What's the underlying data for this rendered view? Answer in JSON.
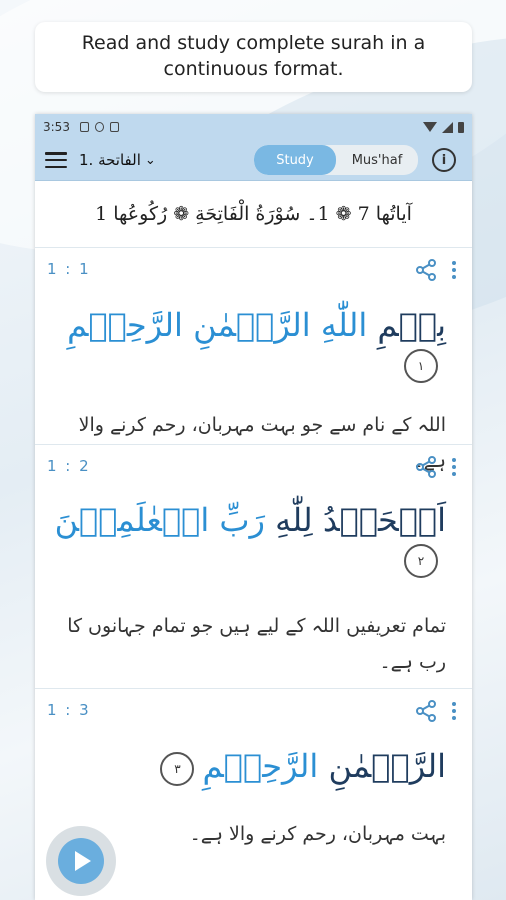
{
  "banner": {
    "text": "Read and study complete surah in a continuous format."
  },
  "status_bar": {
    "time": "3:53"
  },
  "app_bar": {
    "surah_label": "الفاتحة .1",
    "mode_study": "Study",
    "mode_mushaf": "Mus'haf"
  },
  "surah_header": {
    "text": "آیاتُها 7 ❁ 1۔ سُوْرَةُ الْفَاتِحَةِ ❁ رُكُوعُها 1"
  },
  "ayahs": [
    {
      "ref": "1 : 1",
      "arabic_plain": "بِسۡمِ ",
      "arabic_highlight": "اللّٰهِ الرَّحۡمٰنِ الرَّحِیۡمِ",
      "number": "١",
      "translation": "اللہ کے نام سے جو بہت مہربان، رحم کرنے والا ہے۔"
    },
    {
      "ref": "1 : 2",
      "arabic_plain": "اَلۡحَمۡدُ لِلّٰهِ ",
      "arabic_highlight": "رَبِّ الۡعٰلَمِیۡنَ",
      "number": "٢",
      "translation": "تمام تعریفیں اللہ کے لیے ہیں جو تمام جہانوں کا رب ہے۔"
    },
    {
      "ref": "1 : 3",
      "arabic_plain": "الرَّحۡمٰنِ ",
      "arabic_highlight": "الرَّحِیۡمِ",
      "number": "٣",
      "translation": "بہت مہربان، رحم کرنے والا ہے۔"
    }
  ],
  "icons": {
    "menu": "hamburger-icon",
    "dropdown": "chevron-down-icon",
    "info": "info-icon",
    "share": "share-icon",
    "more": "more-vertical-icon",
    "play": "play-icon"
  },
  "colors": {
    "accent": "#4a90c4",
    "appbar": "#bfd9ee",
    "toggle_on": "#7ab8e3"
  }
}
